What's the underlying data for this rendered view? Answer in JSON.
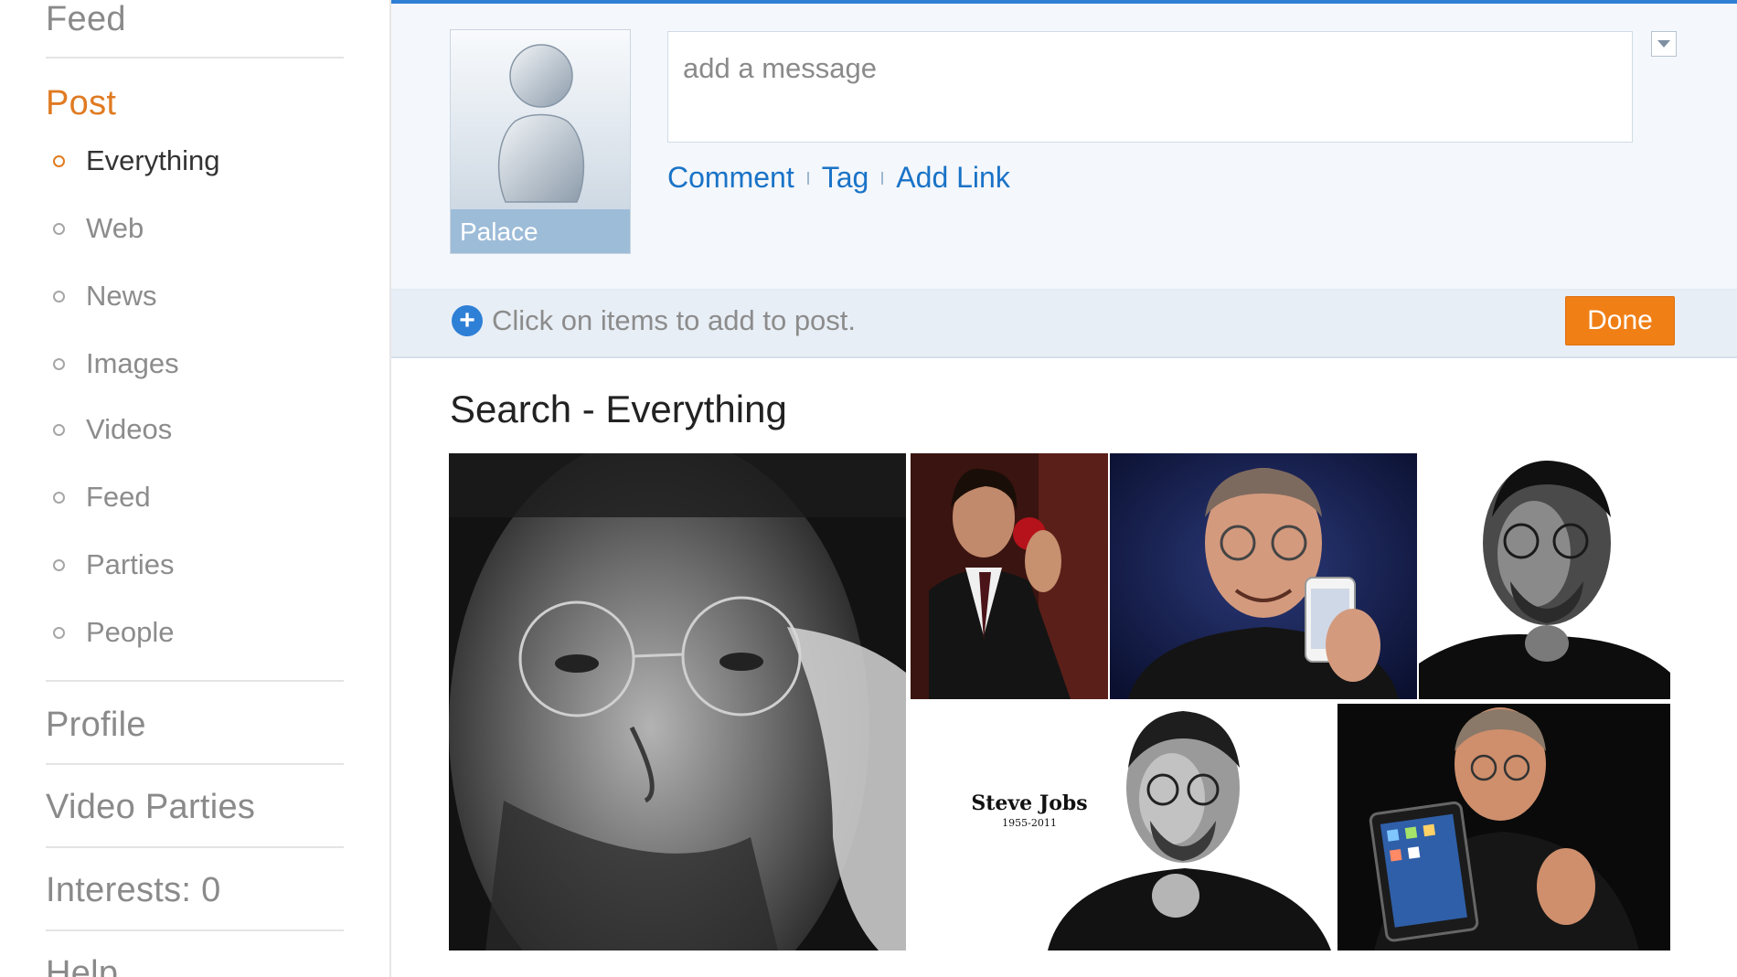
{
  "sidebar": {
    "feed": "Feed",
    "post": "Post",
    "post_items": [
      {
        "label": "Everything",
        "active": true
      },
      {
        "label": "Web",
        "active": false
      },
      {
        "label": "News",
        "active": false
      },
      {
        "label": "Images",
        "active": false
      },
      {
        "label": "Videos",
        "active": false
      },
      {
        "label": "Feed",
        "active": false
      },
      {
        "label": "Parties",
        "active": false
      },
      {
        "label": "People",
        "active": false
      }
    ],
    "profile": "Profile",
    "video_parties": "Video Parties",
    "interests": "Interests: 0",
    "help": "Help"
  },
  "composer": {
    "avatar_name": "Palace",
    "message_placeholder": "add a message",
    "links": {
      "comment": "Comment",
      "tag": "Tag",
      "add_link": "Add Link"
    },
    "dropdown_icon": "chevron-down-icon"
  },
  "add_bar": {
    "icon": "plus-circle-icon",
    "hint": "Click on items to add to post.",
    "done_label": "Done"
  },
  "results": {
    "title": "Search - Everything",
    "images": [
      {
        "caption": ""
      },
      {
        "caption": ""
      },
      {
        "caption": ""
      },
      {
        "caption": ""
      },
      {
        "caption_name": "Steve Jobs",
        "caption_years": "1955-2011"
      },
      {
        "caption": ""
      }
    ]
  },
  "colors": {
    "accent_orange": "#e07b22",
    "link_blue": "#1a73c7",
    "top_accent": "#2f7fd4",
    "done_button": "#f07f16"
  }
}
